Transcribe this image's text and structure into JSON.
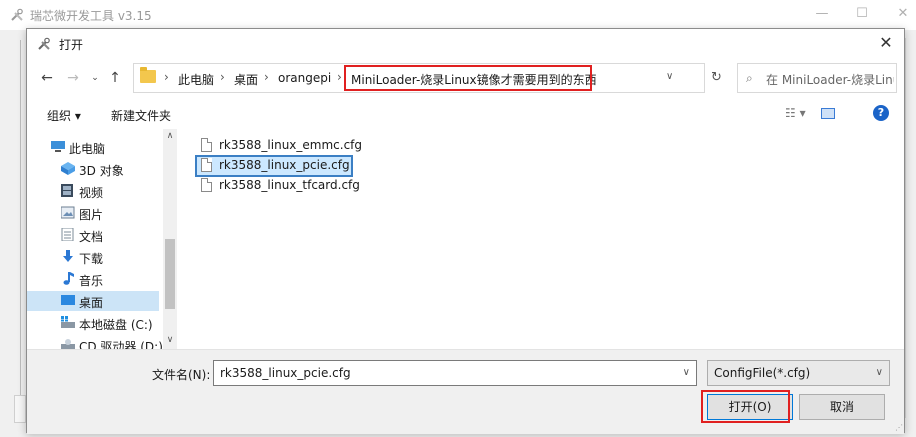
{
  "app": {
    "title": "瑞芯微开发工具 v3.15"
  },
  "dialog": {
    "title": "打开",
    "close_glyph": "✕",
    "address": {
      "segments": [
        "此电脑",
        "桌面",
        "orangepi",
        "MiniLoader-烧录Linux镜像才需要用到的东西"
      ],
      "sep": "›"
    },
    "search_placeholder": "在 MiniLoader-烧录Linux...",
    "toolbar": {
      "organize": "组织 ▾",
      "new_folder": "新建文件夹"
    },
    "nav_items": [
      {
        "label": "此电脑",
        "icon": "pc-icon"
      },
      {
        "label": "3D 对象",
        "icon": "3d-objects-icon"
      },
      {
        "label": "视频",
        "icon": "video-icon"
      },
      {
        "label": "图片",
        "icon": "pictures-icon"
      },
      {
        "label": "文档",
        "icon": "documents-icon"
      },
      {
        "label": "下载",
        "icon": "download-icon"
      },
      {
        "label": "音乐",
        "icon": "music-icon"
      },
      {
        "label": "桌面",
        "icon": "desktop-icon",
        "selected": true
      },
      {
        "label": "本地磁盘 (C:)",
        "icon": "drive-icon"
      },
      {
        "label": "CD 驱动器 (D:)",
        "icon": "cd-drive-icon"
      }
    ],
    "files": [
      {
        "name": "rk3588_linux_emmc.cfg",
        "selected": false
      },
      {
        "name": "rk3588_linux_pcie.cfg",
        "selected": true
      },
      {
        "name": "rk3588_linux_tfcard.cfg",
        "selected": false
      }
    ],
    "filename_label": "文件名(N):",
    "filename_value": "rk3588_linux_pcie.cfg",
    "filetype_value": "ConfigFile(*.cfg)",
    "open_button": "打开(O)",
    "cancel_button": "取消"
  },
  "colors": {
    "highlight": "#e02020",
    "selection": "#cce8ff",
    "accent": "#0078d7"
  }
}
